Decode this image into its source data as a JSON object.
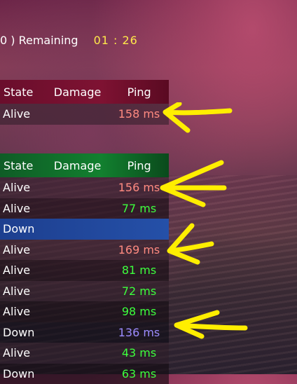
{
  "timer": {
    "label": "0  ) Remaining",
    "value": "01 : 26"
  },
  "panel_top": {
    "header": {
      "state": "State",
      "damage": "Damage",
      "ping": "Ping"
    },
    "rows": [
      {
        "state": "Alive",
        "damage": "",
        "ping": "158 ms"
      }
    ]
  },
  "panel_bottom": {
    "header": {
      "state": "State",
      "damage": "Damage",
      "ping": "Ping"
    },
    "rows": [
      {
        "state": "Alive",
        "damage": "",
        "ping": "156 ms"
      },
      {
        "state": "Alive",
        "damage": "",
        "ping": "77 ms"
      },
      {
        "state": "Down",
        "damage": "",
        "ping": ""
      },
      {
        "state": "Alive",
        "damage": "",
        "ping": "169 ms"
      },
      {
        "state": "Alive",
        "damage": "",
        "ping": "81 ms"
      },
      {
        "state": "Alive",
        "damage": "",
        "ping": "72 ms"
      },
      {
        "state": "Alive",
        "damage": "",
        "ping": "98 ms"
      },
      {
        "state": "Down",
        "damage": "",
        "ping": "136 ms"
      },
      {
        "state": "Alive",
        "damage": "",
        "ping": "43 ms"
      },
      {
        "state": "Down",
        "damage": "",
        "ping": "63 ms"
      }
    ]
  },
  "colors": {
    "arrow": "#ffee00",
    "high_ping": "#ff8a80",
    "low_ping": "#3dff3d",
    "highlight_row": "#2550a8"
  }
}
